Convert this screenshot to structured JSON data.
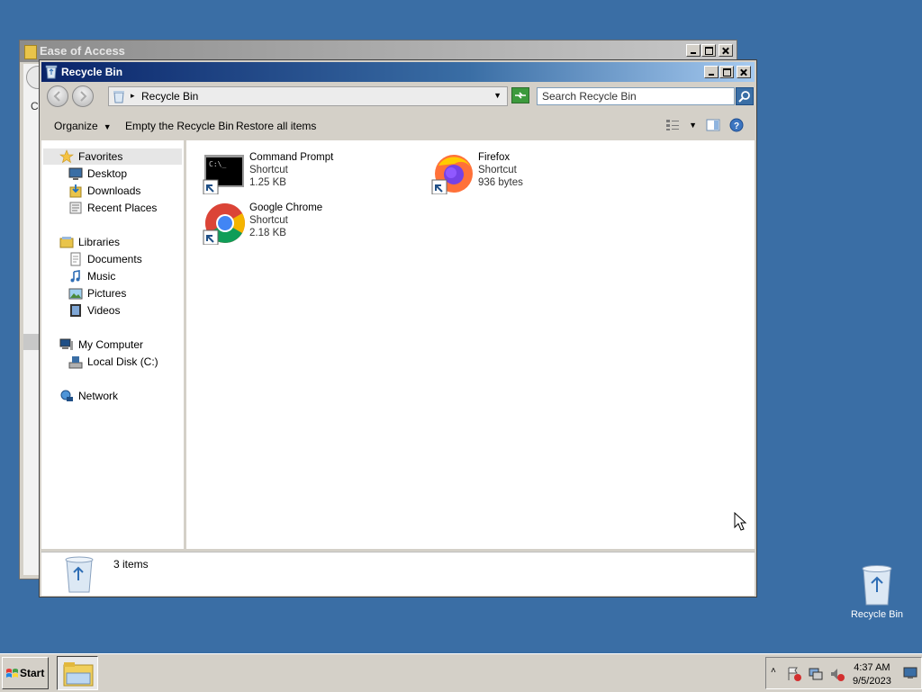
{
  "background_window": {
    "title": "Ease of Access",
    "partial_text": "C"
  },
  "window": {
    "title": "Recycle Bin",
    "address": {
      "path": "Recycle Bin"
    },
    "search": {
      "placeholder": "Search Recycle Bin"
    },
    "toolbar": {
      "organize": "Organize",
      "empty": "Empty the Recycle Bin",
      "restore": "Restore all items"
    },
    "nav": {
      "favorites": "Favorites",
      "desktop": "Desktop",
      "downloads": "Downloads",
      "recent": "Recent Places",
      "libraries": "Libraries",
      "documents": "Documents",
      "music": "Music",
      "pictures": "Pictures",
      "videos": "Videos",
      "computer": "My Computer",
      "localdisk": "Local Disk (C:)",
      "network": "Network"
    },
    "files": [
      {
        "name": "Command Prompt",
        "type": "Shortcut",
        "size": "1.25 KB"
      },
      {
        "name": "Firefox",
        "type": "Shortcut",
        "size": "936 bytes"
      },
      {
        "name": "Google Chrome",
        "type": "Shortcut",
        "size": "2.18 KB"
      }
    ],
    "status": {
      "count": "3 items"
    }
  },
  "desktop": {
    "recycle_bin_label": "Recycle Bin"
  },
  "taskbar": {
    "start": "Start",
    "time": "4:37 AM",
    "date": "9/5/2023"
  },
  "colors": {
    "desktop": "#3a6ea5",
    "titlebar_start": "#0a246a",
    "titlebar_end": "#a6caf0"
  }
}
